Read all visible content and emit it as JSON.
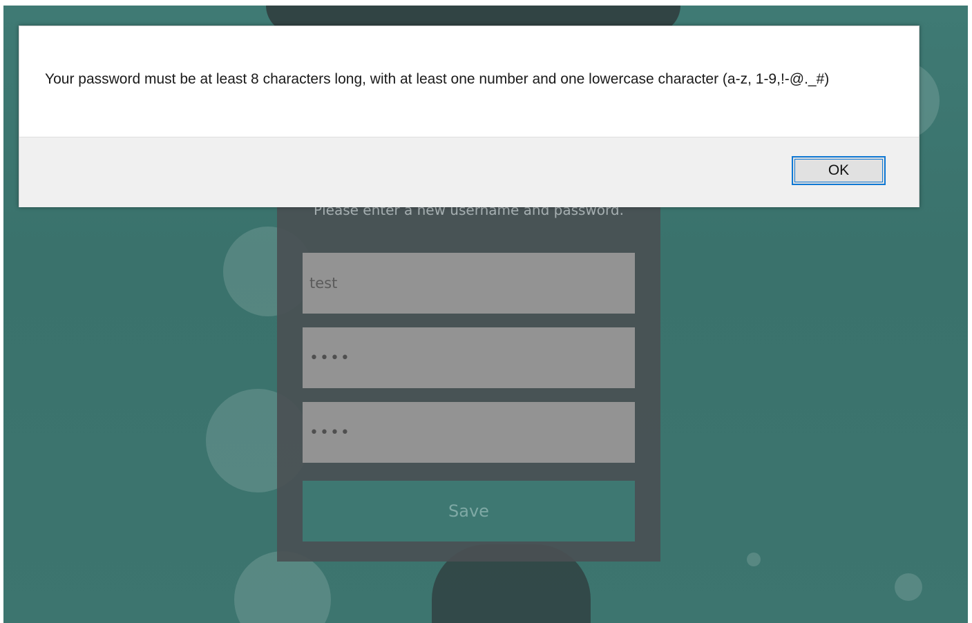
{
  "form": {
    "subtitle": "Please enter a new username and password.",
    "username_value": "test",
    "password_value": "••••",
    "confirm_password_value": "••••",
    "save_label": "Save"
  },
  "dialog": {
    "message": "Your password must be at least 8 characters long, with at least one number and one lowercase character (a-z, 1-9,!-@._#)",
    "ok_label": "OK"
  },
  "colors": {
    "background_teal": "#3d756f",
    "card": "#4a5054",
    "input": "#939393",
    "save_button": "#3e7872",
    "dialog_focus_border": "#0f78d4"
  }
}
